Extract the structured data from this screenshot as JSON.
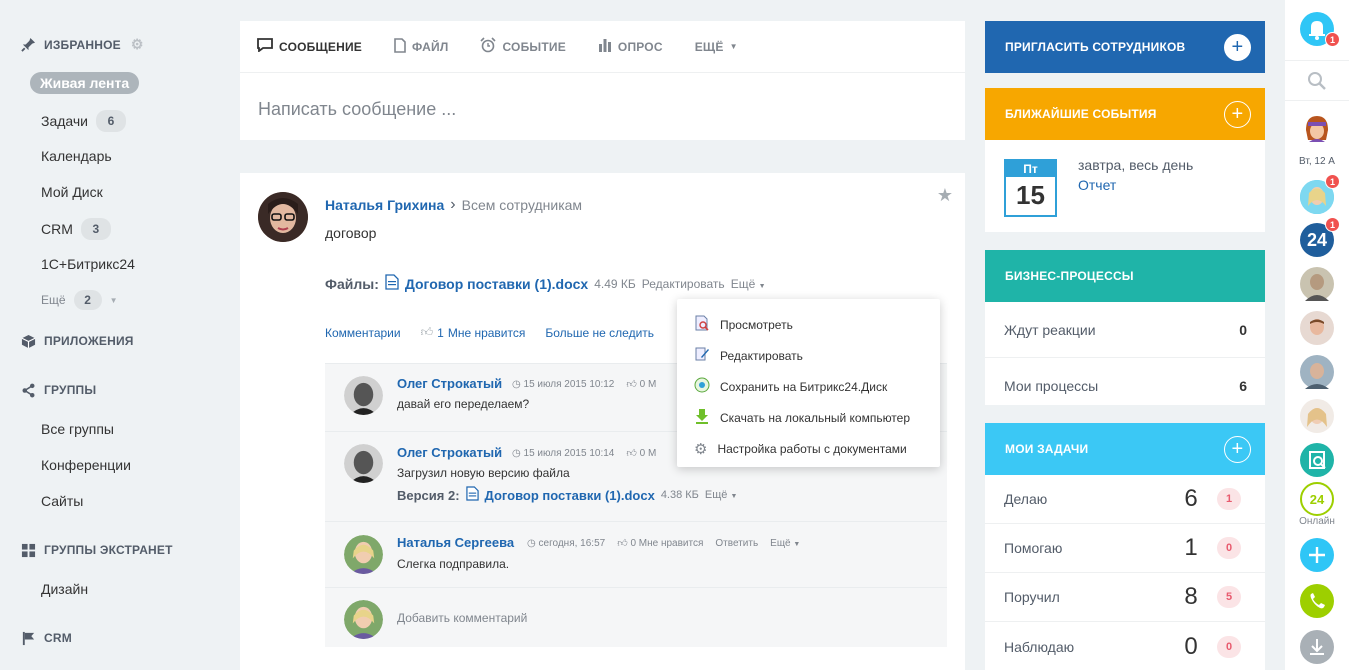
{
  "left": {
    "favorites": "ИЗБРАННОЕ",
    "items": [
      {
        "label": "Живая лента"
      },
      {
        "label": "Задачи",
        "count": "6"
      },
      {
        "label": "Календарь"
      },
      {
        "label": "Мой Диск"
      },
      {
        "label": "CRM",
        "count": "3"
      },
      {
        "label": "1С+Битрикс24"
      }
    ],
    "more": {
      "label": "Ещё",
      "count": "2"
    },
    "apps": "ПРИЛОЖЕНИЯ",
    "groups": "ГРУППЫ",
    "group_items": [
      "Все группы",
      "Конференции",
      "Сайты"
    ],
    "extranet": "ГРУППЫ ЭКСТРАНЕТ",
    "extranet_items": [
      "Дизайн"
    ],
    "crm": "CRM"
  },
  "composer": {
    "tabs": [
      "СООБЩЕНИЕ",
      "ФАЙЛ",
      "СОБЫТИЕ",
      "ОПРОС",
      "ЕЩЁ"
    ],
    "placeholder": "Написать сообщение ..."
  },
  "post": {
    "author": "Наталья Грихина",
    "to": "Всем сотрудникам",
    "text": "договор",
    "files_label": "Файлы:",
    "file_name": "Договор поставки (1).docx",
    "file_size": "4.49 КБ",
    "edit": "Редактировать",
    "more": "Ещё",
    "actions": {
      "comments": "Комментарии",
      "likes": "1",
      "like_label": "Мне нравится",
      "unfollow": "Больше не следить"
    }
  },
  "comments": [
    {
      "name": "Олег Строкатый",
      "time": "15 июля 2015 10:12",
      "likes": "0 М",
      "text": "давай его переделаем?"
    },
    {
      "name": "Олег Строкатый",
      "time": "15 июля 2015 10:14",
      "likes": "0 М",
      "text": "Загрузил новую версию файла",
      "version_label": "Версия 2:",
      "file": "Договор поставки (1).docx",
      "size": "4.38 КБ",
      "more": "Ещё"
    },
    {
      "name": "Наталья Сергеева",
      "time": "сегодня, 16:57",
      "likes": "0 Мне нравится",
      "reply": "Ответить",
      "more": "Ещё",
      "text": "Слегка подправила."
    }
  ],
  "add_comment": "Добавить комментарий",
  "menu": [
    {
      "label": "Просмотреть",
      "icon": "view-icon"
    },
    {
      "label": "Редактировать",
      "icon": "edit-icon"
    },
    {
      "label": "Сохранить на Битрикс24.Диск",
      "icon": "disk-icon"
    },
    {
      "label": "Скачать на локальный компьютер",
      "icon": "download-icon"
    },
    {
      "label": "Настройка работы с документами",
      "icon": "settings-icon"
    }
  ],
  "right": {
    "invite": "ПРИГЛАСИТЬ СОТРУДНИКОВ",
    "events": "БЛИЖАЙШИЕ СОБЫТИЯ",
    "event": {
      "weekday": "Пт",
      "day": "15",
      "when": "завтра, весь день",
      "title": "Отчет"
    },
    "bp": "БИЗНЕС-ПРОЦЕССЫ",
    "bp_rows": [
      {
        "label": "Ждут реакции",
        "value": "0"
      },
      {
        "label": "Мои процессы",
        "value": "6"
      }
    ],
    "tasks": "МОИ ЗАДАЧИ",
    "task_rows": [
      {
        "label": "Делаю",
        "value": "6",
        "badge": "1"
      },
      {
        "label": "Помогаю",
        "value": "1",
        "badge": "0"
      },
      {
        "label": "Поручил",
        "value": "8",
        "badge": "5"
      },
      {
        "label": "Наблюдаю",
        "value": "0",
        "badge": "0"
      }
    ]
  },
  "rbar": {
    "bell_badge": "1",
    "date": "Вт, 12 А",
    "badge2": "1",
    "badge3": "1",
    "online": "Онлайн",
    "b24": "24"
  },
  "colors": {
    "blue": "#2067b0",
    "orange": "#f7a700",
    "teal": "#1fb4a8",
    "sky": "#3bc8f5"
  }
}
